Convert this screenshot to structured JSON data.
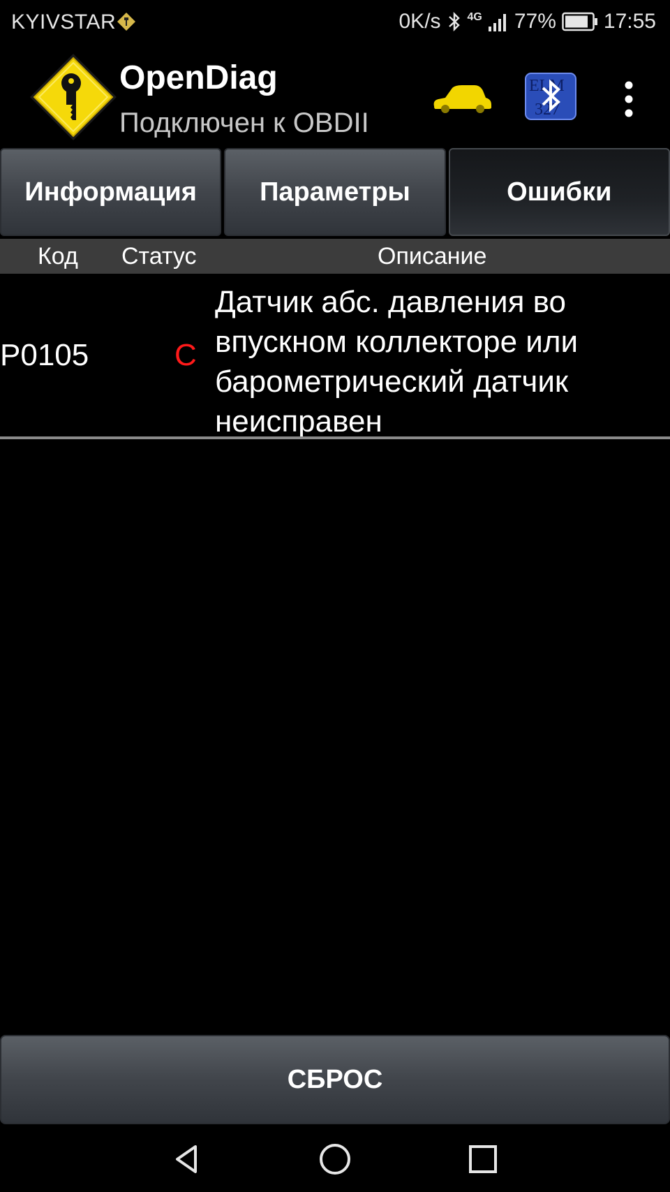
{
  "status_bar": {
    "carrier": "KYIVSTAR",
    "speed": "0K/s",
    "network": "4G",
    "battery": "77%",
    "time": "17:55",
    "icons": [
      "carrier-sim-icon",
      "bluetooth-icon",
      "signal-icon",
      "battery-icon"
    ]
  },
  "app_bar": {
    "title": "OpenDiag",
    "subtitle": "Подключен к OBDII",
    "logo_icon": "key-diamond-logo-icon",
    "car_icon": "car-icon",
    "bluetooth_icon": "elm327-bluetooth-icon",
    "menu_icon": "overflow-menu-icon",
    "logo_color": "#f5d90a",
    "car_color": "#f2d600"
  },
  "tabs": [
    {
      "label": "Информация",
      "active": false
    },
    {
      "label": "Параметры",
      "active": false
    },
    {
      "label": "Ошибки",
      "active": true
    }
  ],
  "table": {
    "headers": {
      "code": "Код",
      "status": "Статус",
      "description": "Описание"
    },
    "rows": [
      {
        "code": "P0105",
        "status": "C",
        "status_color": "#ff1a1a",
        "description": "Датчик абс. давления во впускном коллекторе или барометрический датчик неисправен"
      }
    ]
  },
  "reset_button": {
    "label": "СБРОС"
  },
  "nav_bar": {
    "icons": [
      "back-icon",
      "home-icon",
      "recents-icon"
    ]
  }
}
